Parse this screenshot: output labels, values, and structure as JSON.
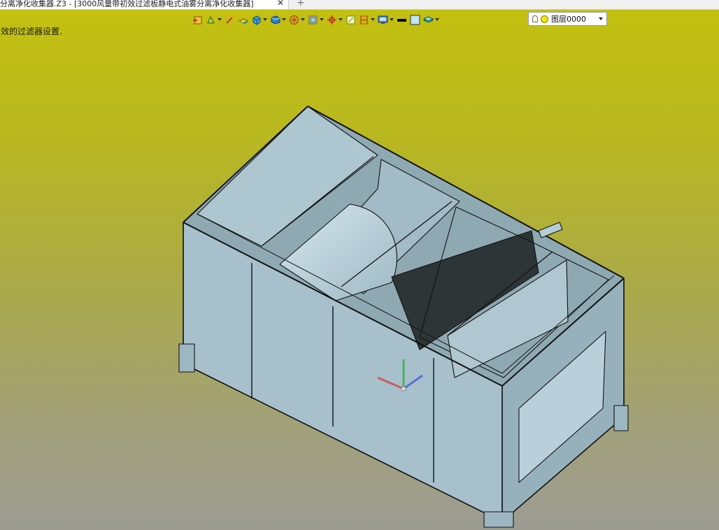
{
  "window": {
    "tab_title": "分离净化收集器.Z3 - [3000风量带初效过滤板静电式油雾分离净化收集器]",
    "tab_close": "✕",
    "tab_add": "+"
  },
  "status_hint": "效的过滤器设置.",
  "toolbar": {
    "icons": [
      "exit-icon",
      "sketch-icon",
      "line-icon",
      "extrude-icon",
      "solid-icon",
      "box-icon",
      "assembly-icon",
      "view-icon",
      "section-icon",
      "point-icon",
      "frame-icon",
      "dimension-icon",
      "render-icon",
      "line-color",
      "fill-color",
      "layer-icon"
    ],
    "layer_combo_value": "图层0000"
  },
  "colors": {
    "panel": "#b9d1dc",
    "panel_dark": "#9db7c2",
    "edge": "#101010",
    "accent_red": "#d43b3b",
    "accent_green": "#2eab3a",
    "accent_blue": "#3a59d4"
  }
}
